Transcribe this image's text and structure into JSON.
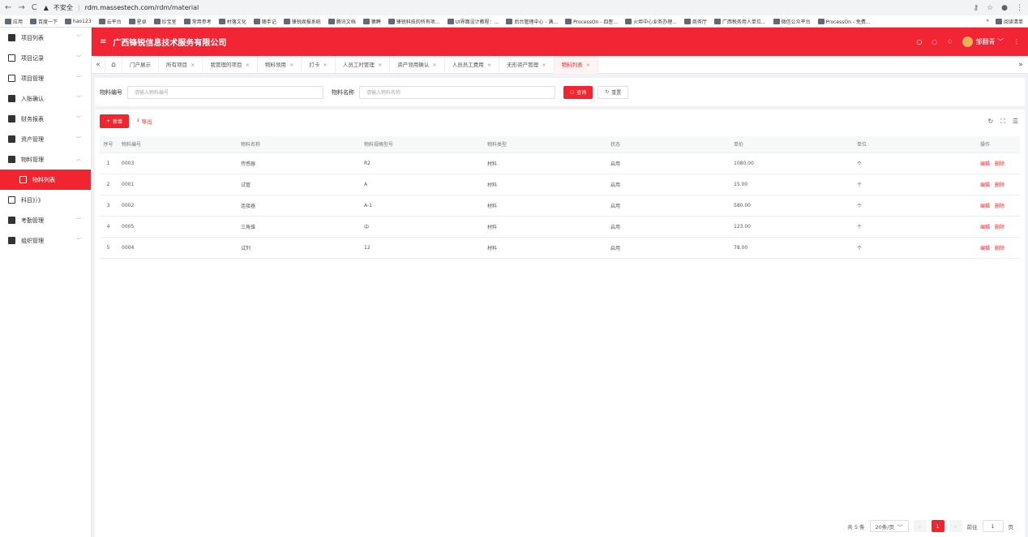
{
  "browser": {
    "back": "←",
    "forward": "→",
    "reload": "C",
    "insecure": "不安全",
    "host": "rdm.massestech.com",
    "path": "/rdm/material"
  },
  "bookmarks": {
    "items": [
      "应用",
      "百度一下",
      "hao123",
      "云平台",
      "星卓",
      "珍宝室",
      "常用参考",
      "村落文化",
      "随手记",
      "锋锐周报系统",
      "腾讯文档",
      "猿聘",
      "锋锐科技的所有项...",
      "UI界面设计教程：...",
      "后台管理中心 - 满...",
      "ProcessOn - 四医...",
      "火炬中心业务办理...",
      "商务厅",
      "广西税务用人单位...",
      "微信公众平台",
      "ProcessOn - 免费..."
    ],
    "more": "»",
    "reading_list": "阅读清单"
  },
  "sidebar": {
    "items": [
      {
        "label": "项目列表",
        "icon": "folder-icon"
      },
      {
        "label": "项目记录",
        "icon": "list-icon"
      },
      {
        "label": "项目管理",
        "icon": "window-icon"
      },
      {
        "label": "入账确认",
        "icon": "flask-icon"
      },
      {
        "label": "财务报表",
        "icon": "report-icon"
      },
      {
        "label": "资产管理",
        "icon": "briefcase-icon"
      },
      {
        "label": "物料管理",
        "icon": "layers-icon"
      },
      {
        "label": "物料列表",
        "icon": "clipboard-icon"
      },
      {
        "label": "科目》）》",
        "icon": "calendar-icon"
      },
      {
        "label": "考勤管理",
        "icon": "attendance-icon"
      },
      {
        "label": "组织管理",
        "icon": "people-icon"
      }
    ]
  },
  "header": {
    "title": "广西锋锐信息技术服务有限公司",
    "username": "邹翻青"
  },
  "tabs": [
    "门户展示",
    "所有项目",
    "我管理的项目",
    "物料领用",
    "打卡",
    "人员工时管理",
    "资产领用确认",
    "人员员工费用",
    "无形资产管理",
    "物料列表"
  ],
  "search": {
    "code_label": "物料编号",
    "code_placeholder": "请输入物料编号",
    "name_label": "物料名称",
    "name_placeholder": "请输入物料名称",
    "query_button": "查询",
    "reset_button": "重置"
  },
  "toolbar": {
    "add_button": "新增",
    "export_button": "导出"
  },
  "table": {
    "headers": [
      "序号",
      "物料编号",
      "物料名称",
      "物料规格型号",
      "物料类型",
      "状态",
      "单价",
      "单位",
      "操作"
    ],
    "rows": [
      {
        "idx": "1",
        "code": "0003",
        "name": "传感器",
        "spec": "R2",
        "type": "材料",
        "status": "启用",
        "price": "1080.00",
        "unit": "个"
      },
      {
        "idx": "2",
        "code": "0001",
        "name": "试管",
        "spec": "A",
        "type": "材料",
        "status": "启用",
        "price": "15.00",
        "unit": "个"
      },
      {
        "idx": "3",
        "code": "0002",
        "name": "连接器",
        "spec": "A-1",
        "type": "材料",
        "status": "启用",
        "price": "580.00",
        "unit": "个"
      },
      {
        "idx": "4",
        "code": "0005",
        "name": "三角锥",
        "spec": "中",
        "type": "材料",
        "status": "启用",
        "price": "123.00",
        "unit": "个"
      },
      {
        "idx": "5",
        "code": "0004",
        "name": "试剂",
        "spec": "12",
        "type": "材料",
        "status": "启用",
        "price": "78.00",
        "unit": "个"
      }
    ],
    "edit_label": "编辑",
    "delete_label": "删除"
  },
  "pager": {
    "total": "共 5 条",
    "page_size": "20条/页",
    "current": "1",
    "goto_label": "前往",
    "goto_value": "1",
    "page_suffix": "页"
  }
}
